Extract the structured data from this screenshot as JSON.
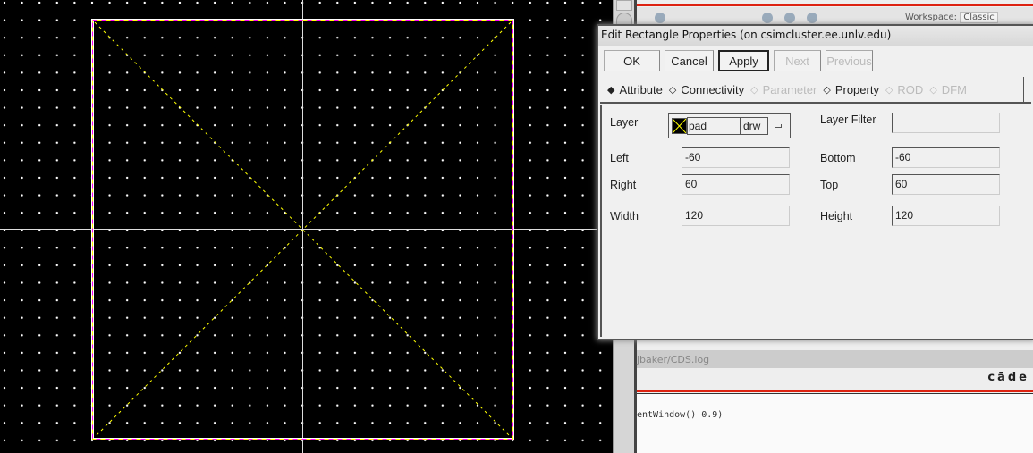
{
  "canvas": {
    "shape": "rectangle",
    "layer_color": "#ffff00",
    "highlight_color": "#ff00ff",
    "grid_color": "#ffffff"
  },
  "background_window": {
    "workspace_label": "Workspace:",
    "workspace_value": "Classic",
    "log_title": "jbaker/CDS.log",
    "brand": "cāde",
    "log_line": "entWindow() 0.9)",
    "accent": "#dd2211"
  },
  "dialog": {
    "title": "Edit Rectangle Properties (on csimcluster.ee.unlv.edu)",
    "buttons": [
      {
        "label": "OK",
        "enabled": true
      },
      {
        "label": "Cancel",
        "enabled": true
      },
      {
        "label": "Apply",
        "enabled": true,
        "default": true
      },
      {
        "label": "Next",
        "enabled": false
      },
      {
        "label": "Previous",
        "enabled": false
      }
    ],
    "tabs": [
      {
        "label": "Attribute",
        "selected": true,
        "enabled": true
      },
      {
        "label": "Connectivity",
        "enabled": true
      },
      {
        "label": "Parameter",
        "enabled": false
      },
      {
        "label": "Property",
        "enabled": true
      },
      {
        "label": "ROD",
        "enabled": false
      },
      {
        "label": "DFM",
        "enabled": false
      }
    ],
    "layer": {
      "label": "Layer",
      "name": "pad",
      "purpose": "drw"
    },
    "layer_filter": {
      "label": "Layer Filter",
      "value": ""
    },
    "fields": {
      "left": {
        "label": "Left",
        "value": "-60"
      },
      "bottom": {
        "label": "Bottom",
        "value": "-60"
      },
      "right": {
        "label": "Right",
        "value": "60"
      },
      "top": {
        "label": "Top",
        "value": "60"
      },
      "width": {
        "label": "Width",
        "value": "120"
      },
      "height": {
        "label": "Height",
        "value": "120"
      }
    }
  }
}
